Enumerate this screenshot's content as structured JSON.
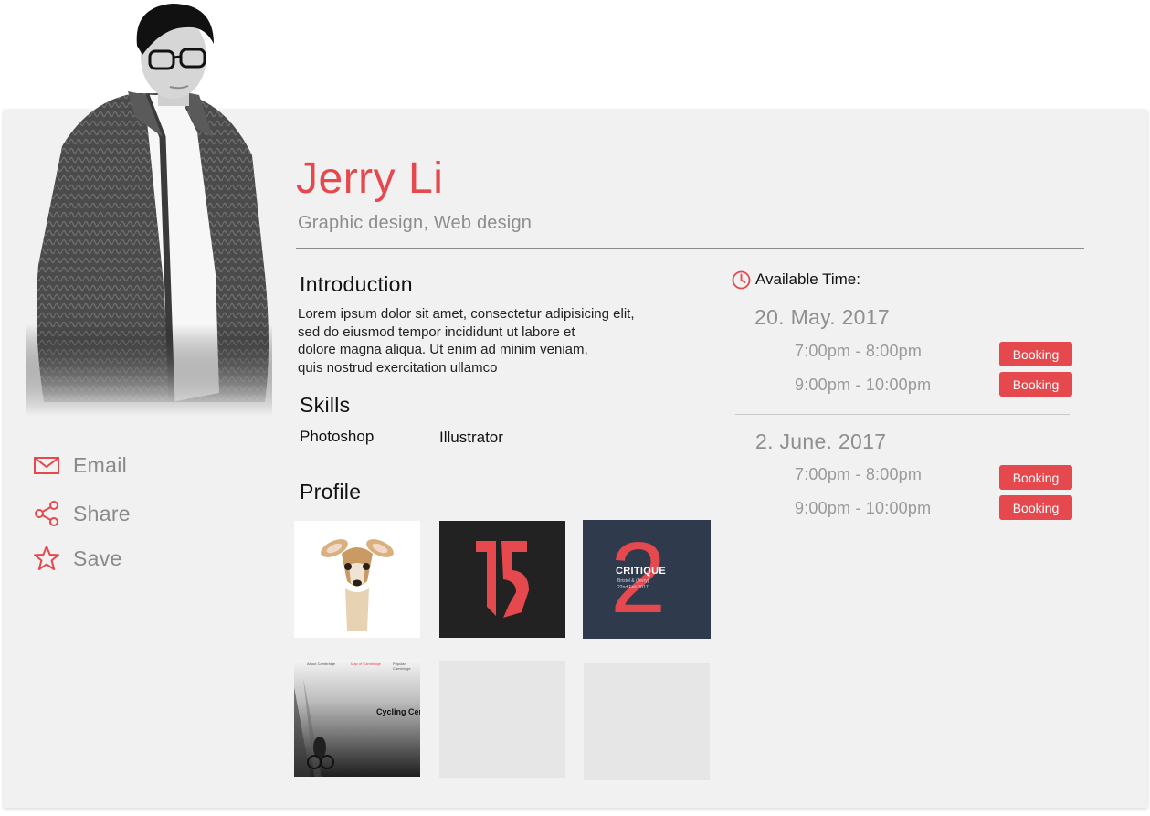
{
  "profile": {
    "name": "Jerry Li",
    "subtitle": "Graphic design, Web design"
  },
  "actions": [
    {
      "label": "Email",
      "icon": "envelope-icon"
    },
    {
      "label": "Share",
      "icon": "share-icon"
    },
    {
      "label": "Save",
      "icon": "star-icon"
    }
  ],
  "introduction": {
    "heading": "Introduction",
    "lines": [
      "Lorem ipsum dolor sit amet, consectetur adipisicing elit,",
      "sed do eiusmod tempor incididunt ut labore et",
      "dolore magna aliqua. Ut enim ad minim veniam,",
      "quis nostrud exercitation ullamco"
    ]
  },
  "skills": {
    "heading": "Skills",
    "items": [
      "Photoshop",
      "Illustrator"
    ]
  },
  "portfolio": {
    "heading": "Profile",
    "thumbs": [
      {
        "kind": "deer-illustration"
      },
      {
        "kind": "number-15-logo"
      },
      {
        "kind": "critique-2-poster",
        "text": "CRITIQUE",
        "numeral": "2",
        "small1": "Bristol & (Jerry)",
        "small2": "22nd Feb 2017"
      },
      {
        "kind": "cycling-website",
        "title": "Cycling Central T",
        "nav": [
          "About Cambridge",
          "Map of Cambridge",
          "Popular Cambridge"
        ]
      },
      {
        "kind": "empty"
      },
      {
        "kind": "empty"
      }
    ]
  },
  "availability": {
    "label": "Available Time:",
    "icon": "clock-icon",
    "days": [
      {
        "date": "20. May. 2017",
        "slots": [
          {
            "time": "7:00pm - 8:00pm",
            "button": "Booking"
          },
          {
            "time": "9:00pm - 10:00pm",
            "button": "Booking"
          }
        ]
      },
      {
        "date": "2. June. 2017",
        "slots": [
          {
            "time": "7:00pm - 8:00pm",
            "button": "Booking"
          },
          {
            "time": "9:00pm - 10:00pm",
            "button": "Booking"
          }
        ]
      }
    ]
  },
  "colors": {
    "accent": "#e5484d",
    "card": "#f1f1f1",
    "muted": "#8d8d8d",
    "navy": "#2f3a4d"
  }
}
